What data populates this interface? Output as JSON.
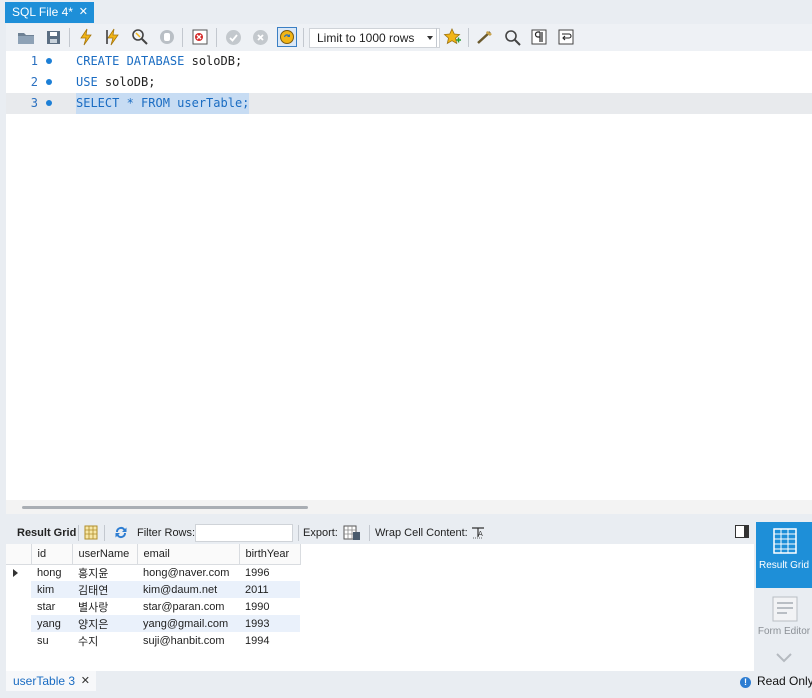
{
  "tabs": {
    "file_tab": {
      "label": "SQL File 4*",
      "close": "✕"
    }
  },
  "toolbar": {
    "limit_select": "Limit to 1000 rows",
    "icons": [
      "open-file-icon",
      "save-icon",
      "execute-icon",
      "execute-current-icon",
      "explain-icon",
      "stop-icon",
      "toggle-error-icon",
      "commit-icon",
      "rollback-icon",
      "autocommit-icon",
      "bookmark-icon",
      "beautify-icon",
      "find-icon",
      "invisible-chars-icon",
      "wrap-icon"
    ]
  },
  "editor": {
    "lines": [
      {
        "num": "1",
        "kw1": "CREATE DATABASE",
        "rest": " soloDB;"
      },
      {
        "num": "2",
        "kw1": "USE",
        "rest": " soloDB;"
      },
      {
        "num": "3",
        "text": "SELECT * FROM userTable;"
      }
    ]
  },
  "result_toolbar": {
    "result_grid_label": "Result Grid",
    "filter_label": "Filter Rows:",
    "filter_value": "",
    "export_label": "Export:",
    "wrap_label": "Wrap Cell Content:"
  },
  "grid": {
    "columns": [
      "id",
      "userName",
      "email",
      "birthYear"
    ],
    "rows": [
      [
        "hong",
        "홍지윤",
        "hong@naver.com",
        "1996"
      ],
      [
        "kim",
        "김태연",
        "kim@daum.net",
        "2011"
      ],
      [
        "star",
        "별사랑",
        "star@paran.com",
        "1990"
      ],
      [
        "yang",
        "양지은",
        "yang@gmail.com",
        "1993"
      ],
      [
        "su",
        "수지",
        "suji@hanbit.com",
        "1994"
      ]
    ]
  },
  "side_panel": {
    "result_grid": "Result Grid",
    "form_editor": "Form Editor"
  },
  "status": {
    "result_tab": "userTable 3",
    "result_tab_close": "✕",
    "read_only": "Read Only",
    "info_glyph": "!"
  },
  "colors": {
    "accent": "#1e8fd8",
    "keyword": "#1a6cc2",
    "selection": "#c7dcf3",
    "alt_row": "#eaf1fb"
  }
}
